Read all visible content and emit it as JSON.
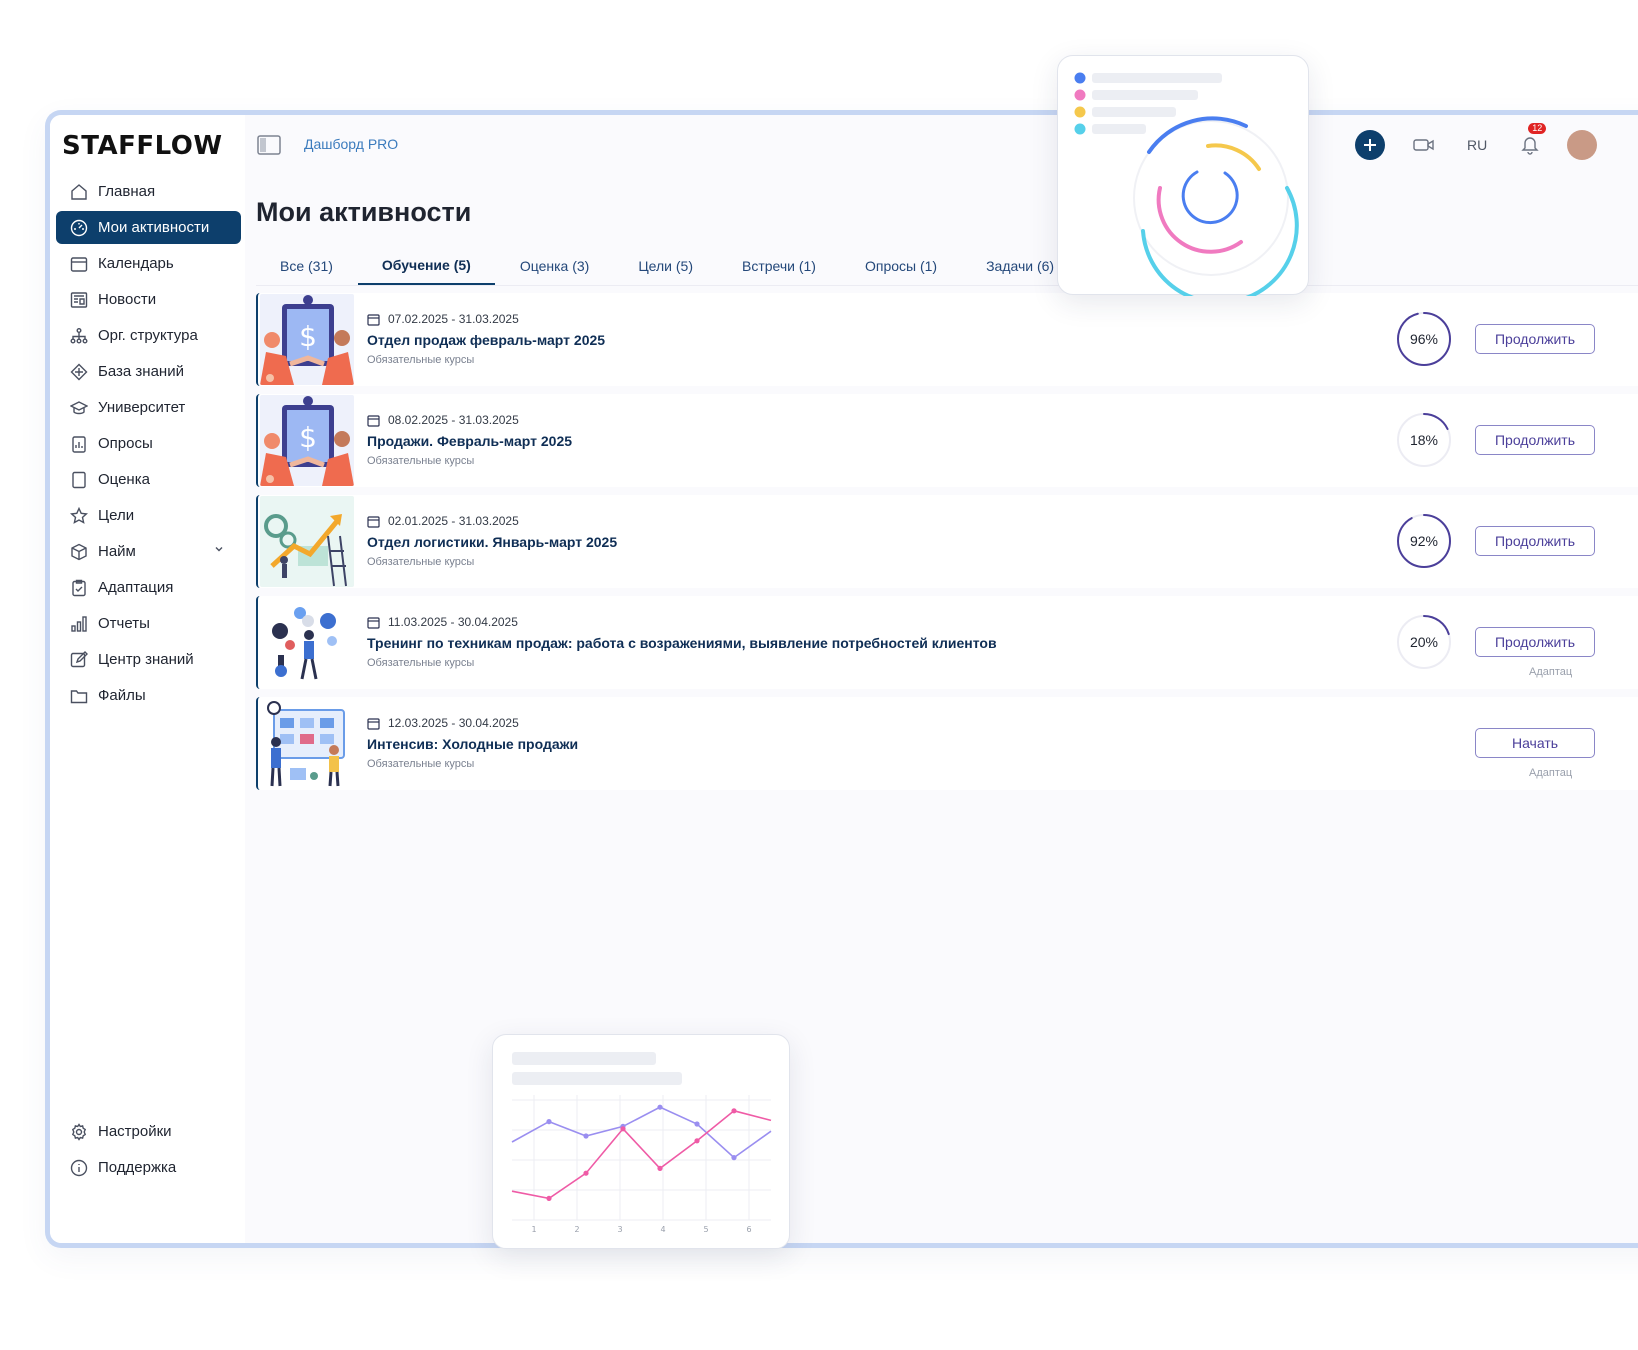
{
  "brand": {
    "logo": "STAFFLOW"
  },
  "sidebar": {
    "items": [
      {
        "label": "Главная",
        "icon": "home-icon"
      },
      {
        "label": "Мои активности",
        "icon": "dashboard-gauge-icon",
        "active": true
      },
      {
        "label": "Календарь",
        "icon": "calendar-icon"
      },
      {
        "label": "Новости",
        "icon": "news-icon"
      },
      {
        "label": "Орг. структура",
        "icon": "org-structure-icon"
      },
      {
        "label": "База знаний",
        "icon": "knowledge-base-icon"
      },
      {
        "label": "Университет",
        "icon": "graduation-cap-icon"
      },
      {
        "label": "Опросы",
        "icon": "survey-icon"
      },
      {
        "label": "Оценка",
        "icon": "assessment-icon"
      },
      {
        "label": "Цели",
        "icon": "star-icon"
      },
      {
        "label": "Найм",
        "icon": "box-icon",
        "expandable": true
      },
      {
        "label": "Адаптация",
        "icon": "clipboard-icon"
      },
      {
        "label": "Отчеты",
        "icon": "bar-chart-icon"
      },
      {
        "label": "Центр знаний",
        "icon": "edit-icon"
      },
      {
        "label": "Файлы",
        "icon": "folder-icon"
      }
    ],
    "bottom": [
      {
        "label": "Настройки",
        "icon": "gear-icon"
      },
      {
        "label": "Поддержка",
        "icon": "info-icon"
      }
    ]
  },
  "header": {
    "breadcrumb": "Дашборд PRO",
    "lang": "RU",
    "notifications": "12"
  },
  "page": {
    "title": "Мои активности",
    "tabs": [
      {
        "label": "Все (31)"
      },
      {
        "label": "Обучение (5)",
        "active": true
      },
      {
        "label": "Оценка (3)"
      },
      {
        "label": "Цели (5)"
      },
      {
        "label": "Встречи (1)"
      },
      {
        "label": "Опросы (1)"
      },
      {
        "label": "Задачи (6)"
      }
    ]
  },
  "courses": [
    {
      "dates": "07.02.2025 - 31.03.2025",
      "title": "Отдел продаж февраль-март 2025",
      "subtitle": "Обязательные курсы",
      "progress_label": "96%",
      "progress": 0.96,
      "button": "Продолжить",
      "note": "",
      "thumb": "sales-handshake-illustration"
    },
    {
      "dates": "08.02.2025 - 31.03.2025",
      "title": "Продажи. Февраль-март 2025",
      "subtitle": "Обязательные курсы",
      "progress_label": "18%",
      "progress": 0.18,
      "button": "Продолжить",
      "note": "",
      "thumb": "sales-handshake-illustration"
    },
    {
      "dates": "02.01.2025 - 31.03.2025",
      "title": "Отдел логистики. Январь-март 2025",
      "subtitle": "Обязательные курсы",
      "progress_label": "92%",
      "progress": 0.92,
      "button": "Продолжить",
      "note": "",
      "thumb": "growth-arrow-illustration"
    },
    {
      "dates": "11.03.2025 - 30.04.2025",
      "title": "Тренинг по техникам продаж: работа с возражениями, выявление потребностей клиентов",
      "subtitle": "Обязательные курсы",
      "progress_label": "20%",
      "progress": 0.2,
      "button": "Продолжить",
      "note": "Адаптац",
      "thumb": "ideas-person-illustration"
    },
    {
      "dates": "12.03.2025 - 30.04.2025",
      "title": "Интенсив: Холодные продажи",
      "subtitle": "Обязательные курсы",
      "progress_label": "",
      "progress": null,
      "button": "Начать",
      "note": "Адаптац",
      "thumb": "board-presentation-illustration"
    }
  ],
  "colors": {
    "primary": "#0d3f6c",
    "ring": "#4b3f9a",
    "ring_track": "#ececf3",
    "float_blue": "#4a7ef0",
    "float_pink": "#f07ac0",
    "float_yellow": "#f5c84c",
    "float_cyan": "#56d0ea",
    "line_purple": "#9a8ef0",
    "line_pink": "#ef5ba6"
  },
  "float_line_chart": {
    "type": "line",
    "x": [
      "1",
      "2",
      "3",
      "4",
      "5",
      "6"
    ],
    "series": [
      {
        "color": "#9a8ef0",
        "values": [
          6.5,
          8.2,
          7.0,
          7.8,
          9.4,
          8.0,
          5.2,
          7.4
        ]
      },
      {
        "color": "#ef5ba6",
        "values": [
          2.4,
          1.8,
          3.9,
          7.6,
          4.3,
          6.6,
          9.1,
          8.3
        ]
      }
    ]
  }
}
